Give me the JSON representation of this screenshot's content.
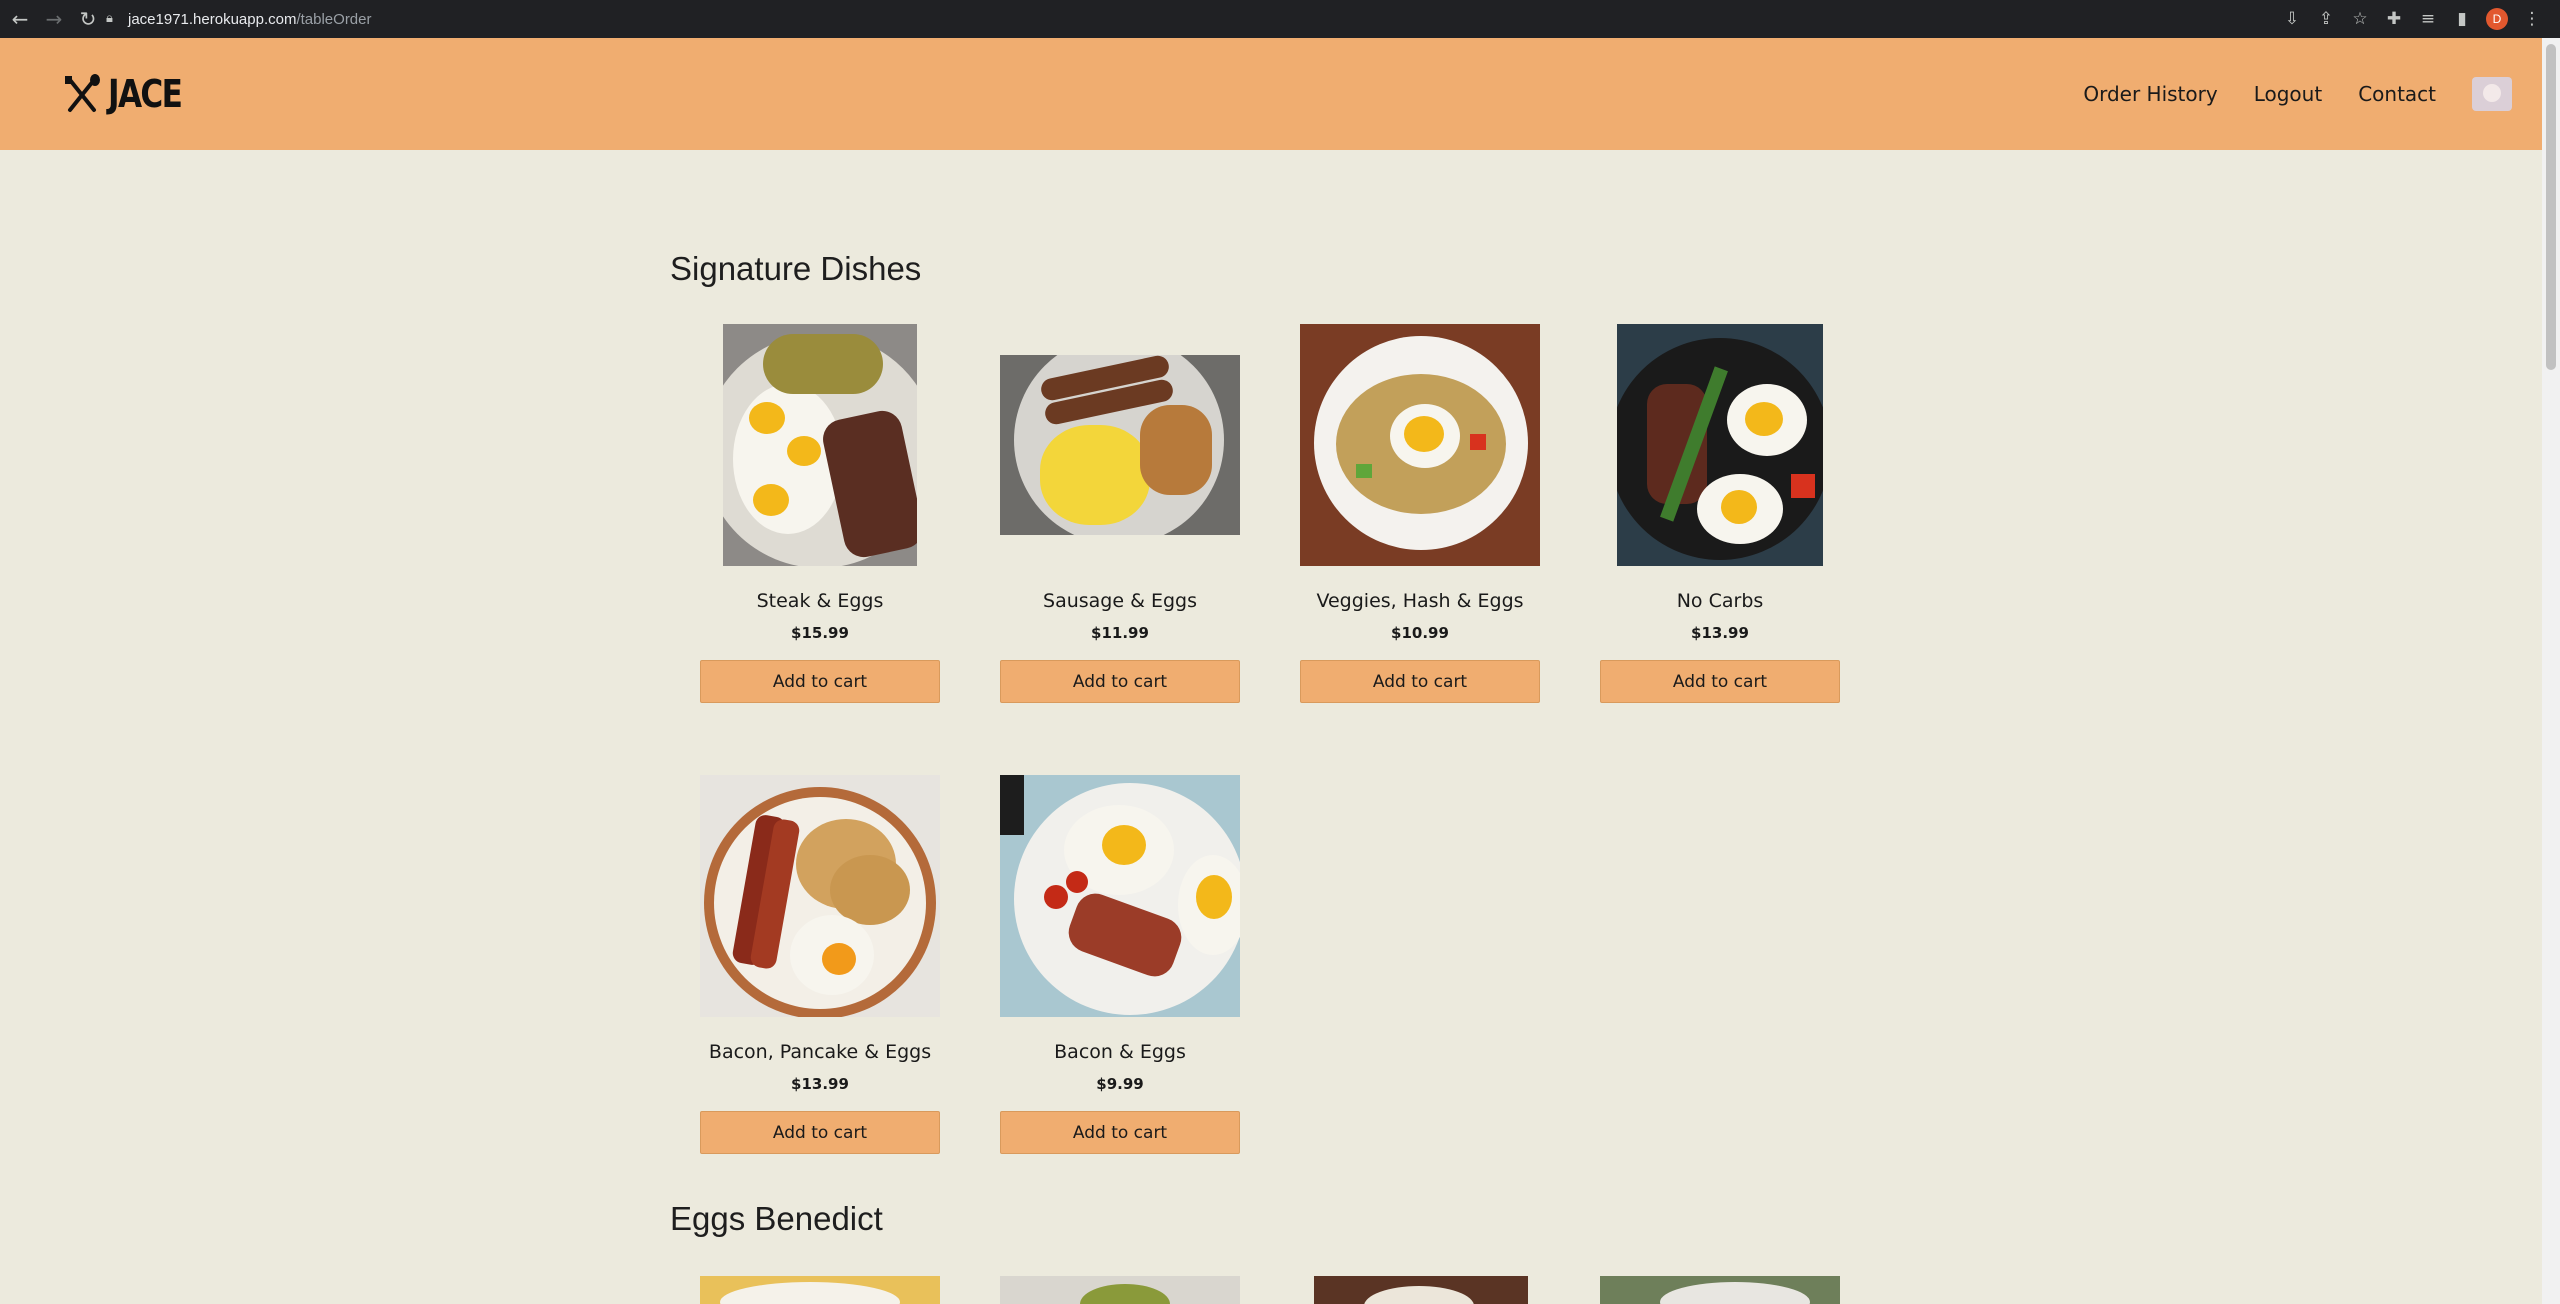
{
  "browser": {
    "url_host": "jace1971.herokuapp.com",
    "url_path": "/tableOrder",
    "profile_initial": "D"
  },
  "header": {
    "logo_text": "JACE",
    "nav": {
      "order_history": "Order History",
      "logout": "Logout",
      "contact": "Contact"
    }
  },
  "sections": [
    {
      "title": "Signature Dishes",
      "items": [
        {
          "name": "Steak & Eggs",
          "price": "$15.99",
          "button": "Add to cart"
        },
        {
          "name": "Sausage & Eggs",
          "price": "$11.99",
          "button": "Add to cart"
        },
        {
          "name": "Veggies, Hash & Eggs",
          "price": "$10.99",
          "button": "Add to cart"
        },
        {
          "name": "No Carbs",
          "price": "$13.99",
          "button": "Add to cart"
        },
        {
          "name": "Bacon, Pancake & Eggs",
          "price": "$13.99",
          "button": "Add to cart"
        },
        {
          "name": "Bacon & Eggs",
          "price": "$9.99",
          "button": "Add to cart"
        }
      ]
    },
    {
      "title": "Eggs Benedict"
    }
  ],
  "colors": {
    "header_bg": "#f0ad70",
    "page_bg": "#eceadd",
    "button_bg": "#f0ad70"
  }
}
